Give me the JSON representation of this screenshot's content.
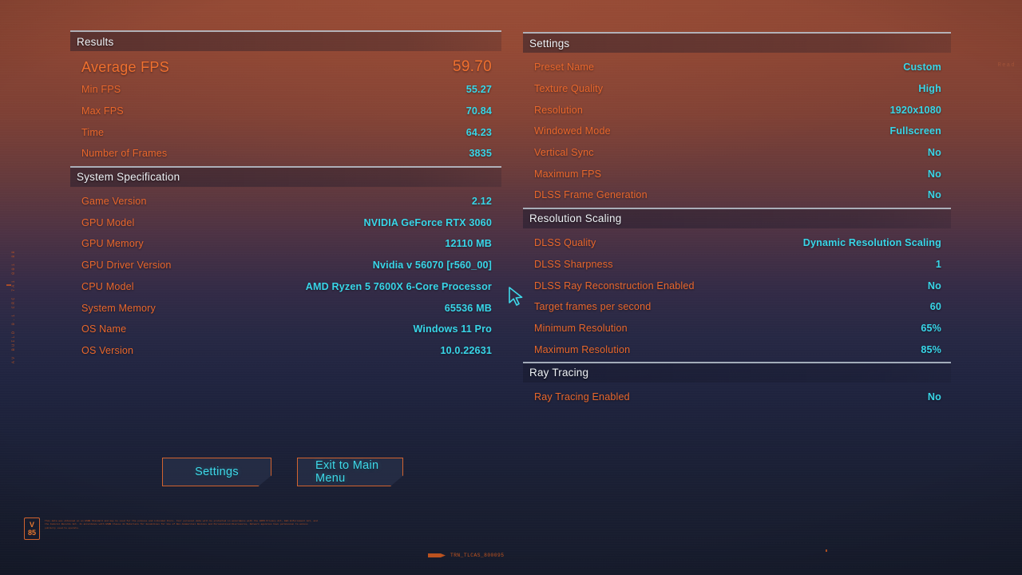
{
  "theme": {
    "label_color": "#e8672c",
    "value_color": "#38d6e8",
    "hero_color": "#f0702f",
    "header_text_color": "#eef2f6",
    "button_border_color": "#d1632f",
    "button_text_color": "#3fd9ea",
    "bg_top": "#8d4634",
    "bg_bottom": "#161b2c"
  },
  "left_panel": {
    "sections": [
      {
        "title": "Results",
        "rows": [
          {
            "label": "Average FPS",
            "value": "59.70",
            "hero": true
          },
          {
            "label": "Min FPS",
            "value": "55.27"
          },
          {
            "label": "Max FPS",
            "value": "70.84"
          },
          {
            "label": "Time",
            "value": "64.23"
          },
          {
            "label": "Number of Frames",
            "value": "3835"
          }
        ]
      },
      {
        "title": "System Specification",
        "rows": [
          {
            "label": "Game Version",
            "value": "2.12"
          },
          {
            "label": "GPU Model",
            "value": "NVIDIA GeForce RTX 3060"
          },
          {
            "label": "GPU Memory",
            "value": "12110 MB"
          },
          {
            "label": "GPU Driver Version",
            "value": "Nvidia v 56070 [r560_00]"
          },
          {
            "label": "CPU Model",
            "value": "AMD Ryzen 5 7600X 6-Core Processor"
          },
          {
            "label": "System Memory",
            "value": "65536 MB"
          },
          {
            "label": "OS Name",
            "value": "Windows 11 Pro"
          },
          {
            "label": "OS Version",
            "value": "10.0.22631"
          }
        ]
      }
    ]
  },
  "right_panel": {
    "sections": [
      {
        "title": "Settings",
        "rows": [
          {
            "label": "Preset Name",
            "value": "Custom"
          },
          {
            "label": "Texture Quality",
            "value": "High"
          },
          {
            "label": "Resolution",
            "value": "1920x1080"
          },
          {
            "label": "Windowed Mode",
            "value": "Fullscreen"
          },
          {
            "label": "Vertical Sync",
            "value": "No"
          },
          {
            "label": "Maximum FPS",
            "value": "No"
          },
          {
            "label": "DLSS Frame Generation",
            "value": "No"
          }
        ]
      },
      {
        "title": "Resolution Scaling",
        "rows": [
          {
            "label": "DLSS Quality",
            "value": "Dynamic Resolution Scaling"
          },
          {
            "label": "DLSS Sharpness",
            "value": "1"
          },
          {
            "label": "DLSS Ray Reconstruction Enabled",
            "value": "No"
          },
          {
            "label": "Target frames per second",
            "value": "60"
          },
          {
            "label": "Minimum Resolution",
            "value": "65%"
          },
          {
            "label": "Maximum Resolution",
            "value": "85%"
          }
        ]
      },
      {
        "title": "Ray Tracing",
        "rows": [
          {
            "label": "Ray Tracing Enabled",
            "value": "No"
          }
        ]
      }
    ]
  },
  "buttons": {
    "settings_label": "Settings",
    "exit_label": "Exit to Main Menu"
  },
  "chrome": {
    "side_code": "AV BUILD 0.1 CRC 7A1 001 88",
    "right_faint": "Read",
    "rating_letter": "V",
    "rating_number": "85",
    "legal_text": "This data was obtained on an ESRB Standard and may be used for the purpose and intended there. Your personal data will be protected in accordance with the GDPR Privacy Act, EEA Enforcement Act, and the Federal Records Act. In accordance with ESRB Clause 4c Materials for Guidelines for Use of Non-Commercial Devices and Personalised Disclosures, Network agencies have permission to access publicly used to operate.",
    "build_id": "TRN_TLCAS_800095"
  }
}
